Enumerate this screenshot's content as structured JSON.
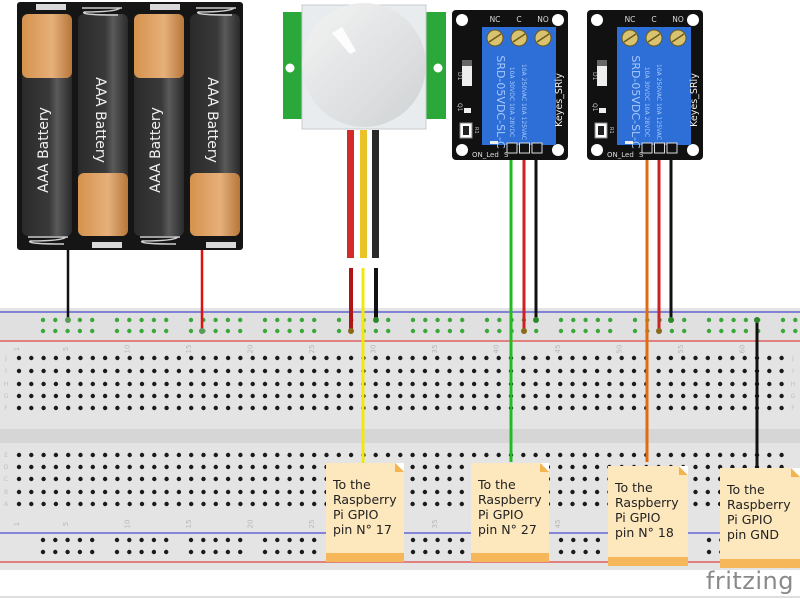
{
  "diagram": {
    "type": "breadboard-wiring",
    "battery_pack": {
      "label": "AAA Battery",
      "cell_count": 4,
      "cells": [
        "AAA Battery",
        "AAA Battery",
        "AAA Battery",
        "AAA Battery"
      ],
      "wires": [
        {
          "color": "#111111",
          "role": "negative"
        },
        {
          "color": "#dd1111",
          "role": "positive"
        }
      ]
    },
    "pir_sensor": {
      "name": "PIR motion sensor",
      "wires": [
        {
          "color": "#d32a2a",
          "role": "VCC"
        },
        {
          "color": "#f2d20c",
          "role": "OUT"
        },
        {
          "color": "#222222",
          "role": "GND"
        }
      ]
    },
    "relays": [
      {
        "id": "relay-1",
        "terminals": [
          "NC",
          "C",
          "NO"
        ],
        "model": "SRD-05VDC-SL-C",
        "ratings": [
          "10A 250VAC  10A 125VAC",
          "10A 30VDC  10A 28VDC"
        ],
        "brand": "Keyes_SRly",
        "labels": [
          "D1",
          "Q1",
          "R1"
        ],
        "led_label": "ON_Led",
        "pin_labels": [
          "S",
          "+",
          "-"
        ],
        "wires": [
          {
            "color": "#22aa22",
            "role": "S"
          },
          {
            "color": "#cc2222",
            "role": "VCC"
          },
          {
            "color": "#111111",
            "role": "GND"
          }
        ]
      },
      {
        "id": "relay-2",
        "terminals": [
          "NC",
          "C",
          "NO"
        ],
        "model": "SRD-05VDC-SL-C",
        "ratings": [
          "10A 250VAC  10A 125VAC",
          "10A 30VDC  10A 28VDC"
        ],
        "brand": "Keyes_SRly",
        "labels": [
          "D1",
          "Q1",
          "R1"
        ],
        "led_label": "ON_Led",
        "pin_labels": [
          "S",
          "+",
          "-"
        ],
        "wires": [
          {
            "color": "#e06c10",
            "role": "S"
          },
          {
            "color": "#cc2222",
            "role": "VCC"
          },
          {
            "color": "#111111",
            "role": "GND"
          }
        ]
      }
    ],
    "breadboard": {
      "row_labels_top": [
        "J",
        "I",
        "H",
        "G",
        "F"
      ],
      "row_labels_bottom": [
        "E",
        "D",
        "C",
        "B",
        "A"
      ],
      "column_numbers": [
        "1",
        "5",
        "10",
        "15",
        "20",
        "25",
        "30",
        "35",
        "40",
        "45",
        "50",
        "55",
        "60"
      ]
    },
    "notes": [
      {
        "id": "note-gpio17",
        "lines": [
          "To the",
          "Raspberry",
          "Pi GPIO",
          "pin N° 17"
        ],
        "wire_color": "#f2e80c"
      },
      {
        "id": "note-gpio27",
        "lines": [
          "To the",
          "Raspberry",
          "Pi GPIO",
          "pin N° 27"
        ],
        "wire_color": "#22bb22"
      },
      {
        "id": "note-gpio18",
        "lines": [
          "To the",
          "Raspberry",
          "Pi GPIO",
          "pin N° 18"
        ],
        "wire_color": "#e06c10"
      },
      {
        "id": "note-gnd",
        "lines": [
          "To the",
          "Raspberry",
          "Pi GPIO",
          "pin GND"
        ],
        "wire_color": "#111111"
      }
    ],
    "watermark": "fritzing",
    "colors": {
      "breadboard": "#e4e4e4",
      "rail_blue": "#4a4ad0",
      "rail_red": "#e04545",
      "rail_hole": "#39a839",
      "hole": "#1a1a1a",
      "relay_pcb": "#111111",
      "relay_body": "#2d6fd6",
      "pir_pcb": "#2aa83a",
      "note_bg": "#fde7bd",
      "note_bar": "#f6b65a"
    }
  }
}
